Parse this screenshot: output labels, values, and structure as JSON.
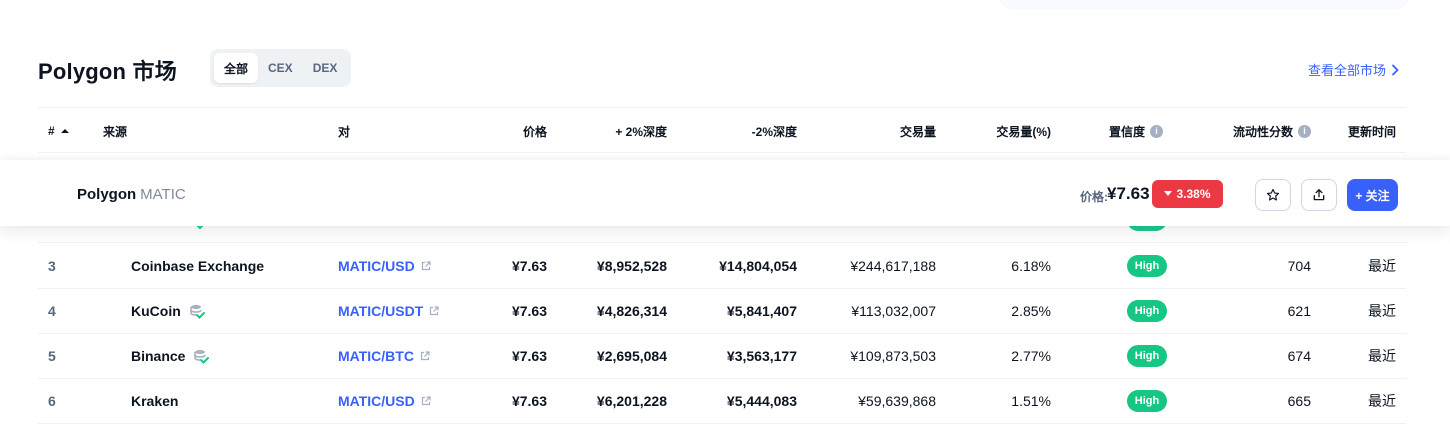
{
  "header": {
    "title": "Polygon 市场",
    "segments": [
      "全部",
      "CEX",
      "DEX"
    ],
    "view_all": "查看全部市场"
  },
  "table": {
    "columns": {
      "rank": "#",
      "source": "来源",
      "pair": "对",
      "price": "价格",
      "depth_plus": "+ 2%深度",
      "depth_minus": "-2%深度",
      "volume": "交易量",
      "volume_pct": "交易量(%)",
      "confidence": "置信度",
      "liquidity": "流动性分数",
      "updated": "更新时间"
    },
    "rows": [
      {
        "rank": "3",
        "source": "Coinbase Exchange",
        "pair": "MATIC/USD",
        "price": "¥7.63",
        "depth_plus": "¥8,952,528",
        "depth_minus": "¥14,804,054",
        "volume": "¥244,617,188",
        "volume_pct": "6.18%",
        "confidence": "High",
        "liquidity": "704",
        "updated": "最近"
      },
      {
        "rank": "4",
        "source": "KuCoin",
        "pair": "MATIC/USDT",
        "price": "¥7.63",
        "depth_plus": "¥4,826,314",
        "depth_minus": "¥5,841,407",
        "volume": "¥113,032,007",
        "volume_pct": "2.85%",
        "confidence": "High",
        "liquidity": "621",
        "updated": "最近"
      },
      {
        "rank": "5",
        "source": "Binance",
        "pair": "MATIC/BTC",
        "price": "¥7.63",
        "depth_plus": "¥2,695,084",
        "depth_minus": "¥3,563,177",
        "volume": "¥109,873,503",
        "volume_pct": "2.77%",
        "confidence": "High",
        "liquidity": "674",
        "updated": "最近"
      },
      {
        "rank": "6",
        "source": "Kraken",
        "pair": "MATIC/USD",
        "price": "¥7.63",
        "depth_plus": "¥6,201,228",
        "depth_minus": "¥5,444,083",
        "volume": "¥59,639,868",
        "volume_pct": "1.51%",
        "confidence": "High",
        "liquidity": "665",
        "updated": "最近"
      }
    ]
  },
  "sticky": {
    "coin_name": "Polygon",
    "coin_symbol": "MATIC",
    "price_label": "价格:",
    "price": "¥7.63",
    "change": "3.38%",
    "follow": "+ 关注"
  },
  "colors": {
    "accent": "#3861fb",
    "positive": "#16c784",
    "negative": "#ea3943",
    "verified": "#16c784"
  }
}
